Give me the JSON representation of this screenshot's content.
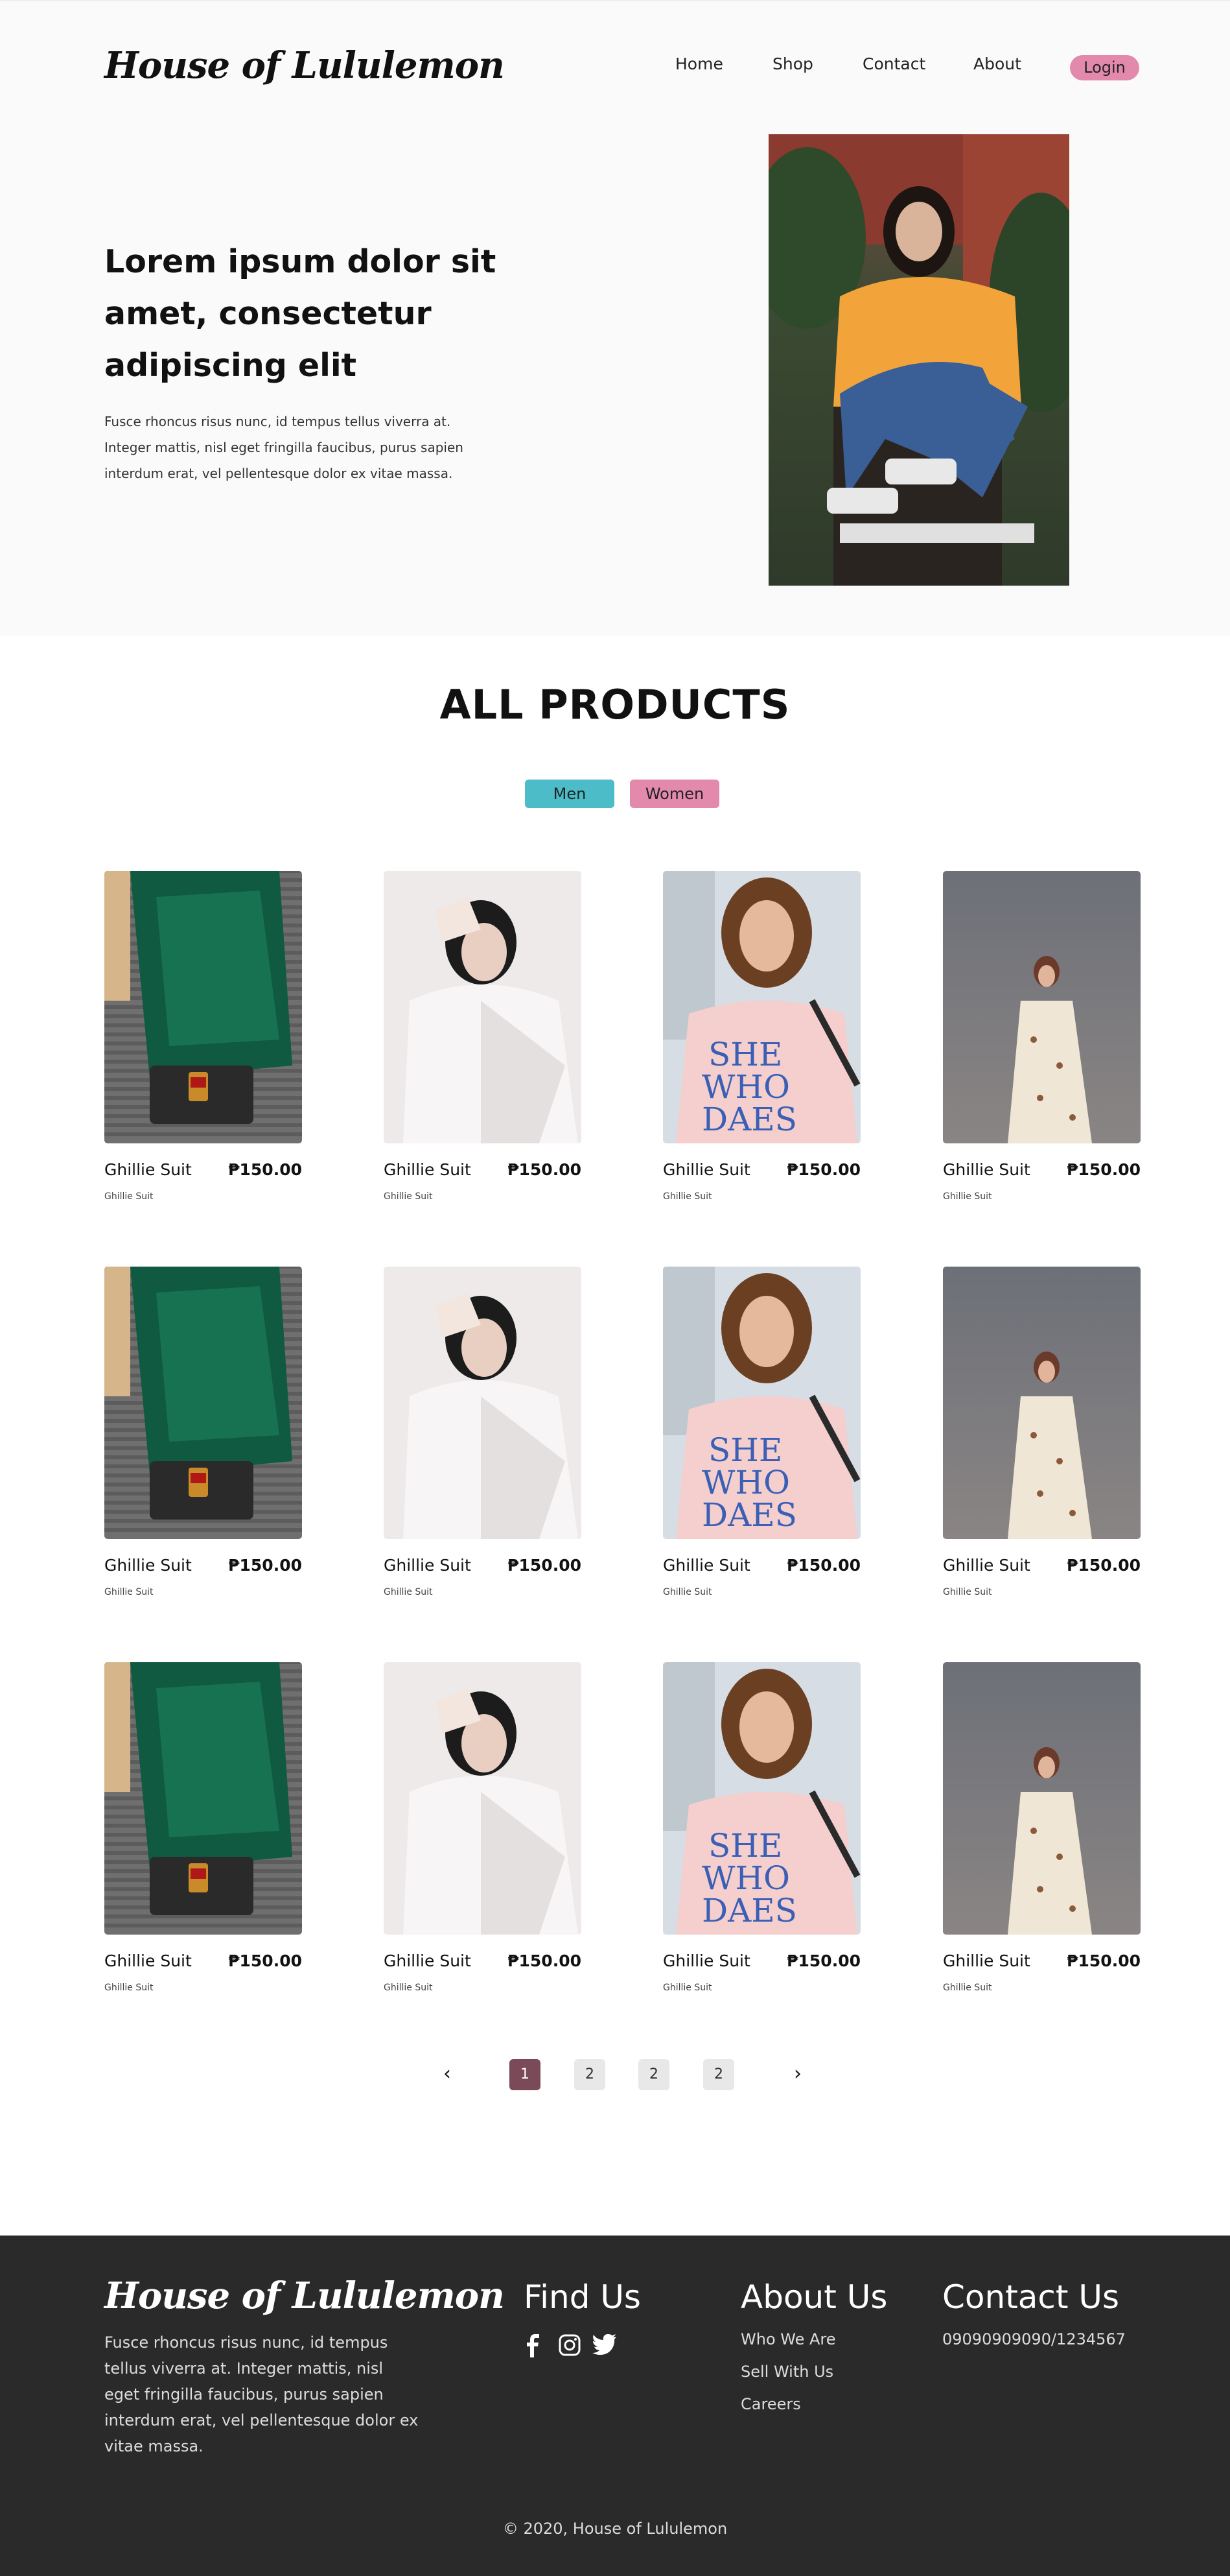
{
  "header": {
    "brand": "House of Lululemon",
    "nav": [
      "Home",
      "Shop",
      "Contact",
      "About"
    ],
    "login": "Login"
  },
  "hero": {
    "title": "Lorem ipsum dolor sit amet, consectetur adipiscing elit",
    "text": "Fusce rhoncus risus nunc, id tempus tellus viverra at. Integer mattis, nisl eget fringilla faucibus, purus sapien interdum erat, vel pellentesque dolor ex vitae massa."
  },
  "products": {
    "title": "ALL PRODUCTS",
    "filters": [
      "Men",
      "Women"
    ],
    "rows": [
      [
        {
          "name": "Ghillie Suit",
          "price": "₱150.00",
          "sub": "Ghillie Suit"
        },
        {
          "name": "Ghillie Suit",
          "price": "₱150.00",
          "sub": "Ghillie Suit"
        },
        {
          "name": "Ghillie Suit",
          "price": "₱150.00",
          "sub": "Ghillie Suit"
        },
        {
          "name": "Ghillie Suit",
          "price": "₱150.00",
          "sub": "Ghillie Suit"
        }
      ],
      [
        {
          "name": "Ghillie Suit",
          "price": "₱150.00",
          "sub": "Ghillie Suit"
        },
        {
          "name": "Ghillie Suit",
          "price": "₱150.00",
          "sub": "Ghillie Suit"
        },
        {
          "name": "Ghillie Suit",
          "price": "₱150.00",
          "sub": "Ghillie Suit"
        },
        {
          "name": "Ghillie Suit",
          "price": "₱150.00",
          "sub": "Ghillie Suit"
        }
      ],
      [
        {
          "name": "Ghillie Suit",
          "price": "₱150.00",
          "sub": "Ghillie Suit"
        },
        {
          "name": "Ghillie Suit",
          "price": "₱150.00",
          "sub": "Ghillie Suit"
        },
        {
          "name": "Ghillie Suit",
          "price": "₱150.00",
          "sub": "Ghillie Suit"
        },
        {
          "name": "Ghillie Suit",
          "price": "₱150.00",
          "sub": "Ghillie Suit"
        }
      ]
    ]
  },
  "pagination": {
    "prev_icon": "chevron-left-icon",
    "next_icon": "chevron-right-icon",
    "pages": [
      "1",
      "2",
      "2",
      "2"
    ],
    "current": "1"
  },
  "footer": {
    "brand": "House of Lululemon",
    "about": "Fusce rhoncus risus nunc, id tempus tellus viverra at. Integer mattis, nisl eget fringilla faucibus, purus sapien interdum erat, vel pellentesque dolor ex vitae massa.",
    "find_us": "Find Us",
    "social_icons": [
      "facebook-icon",
      "instagram-icon",
      "twitter-icon"
    ],
    "about_us": "About Us",
    "about_links": [
      "Who We Are",
      "Sell With Us",
      "Careers"
    ],
    "contact_us": "Contact Us",
    "contact_phone": "09090909090/1234567",
    "copyright": "© 2020, House of Lululemon"
  },
  "colors": {
    "login_pink": "#e38aac",
    "men_teal": "#4bbcc8",
    "page_active": "#7a4a58",
    "footer_bg": "#2a2a2a",
    "hero_bg": "#fafafa"
  }
}
